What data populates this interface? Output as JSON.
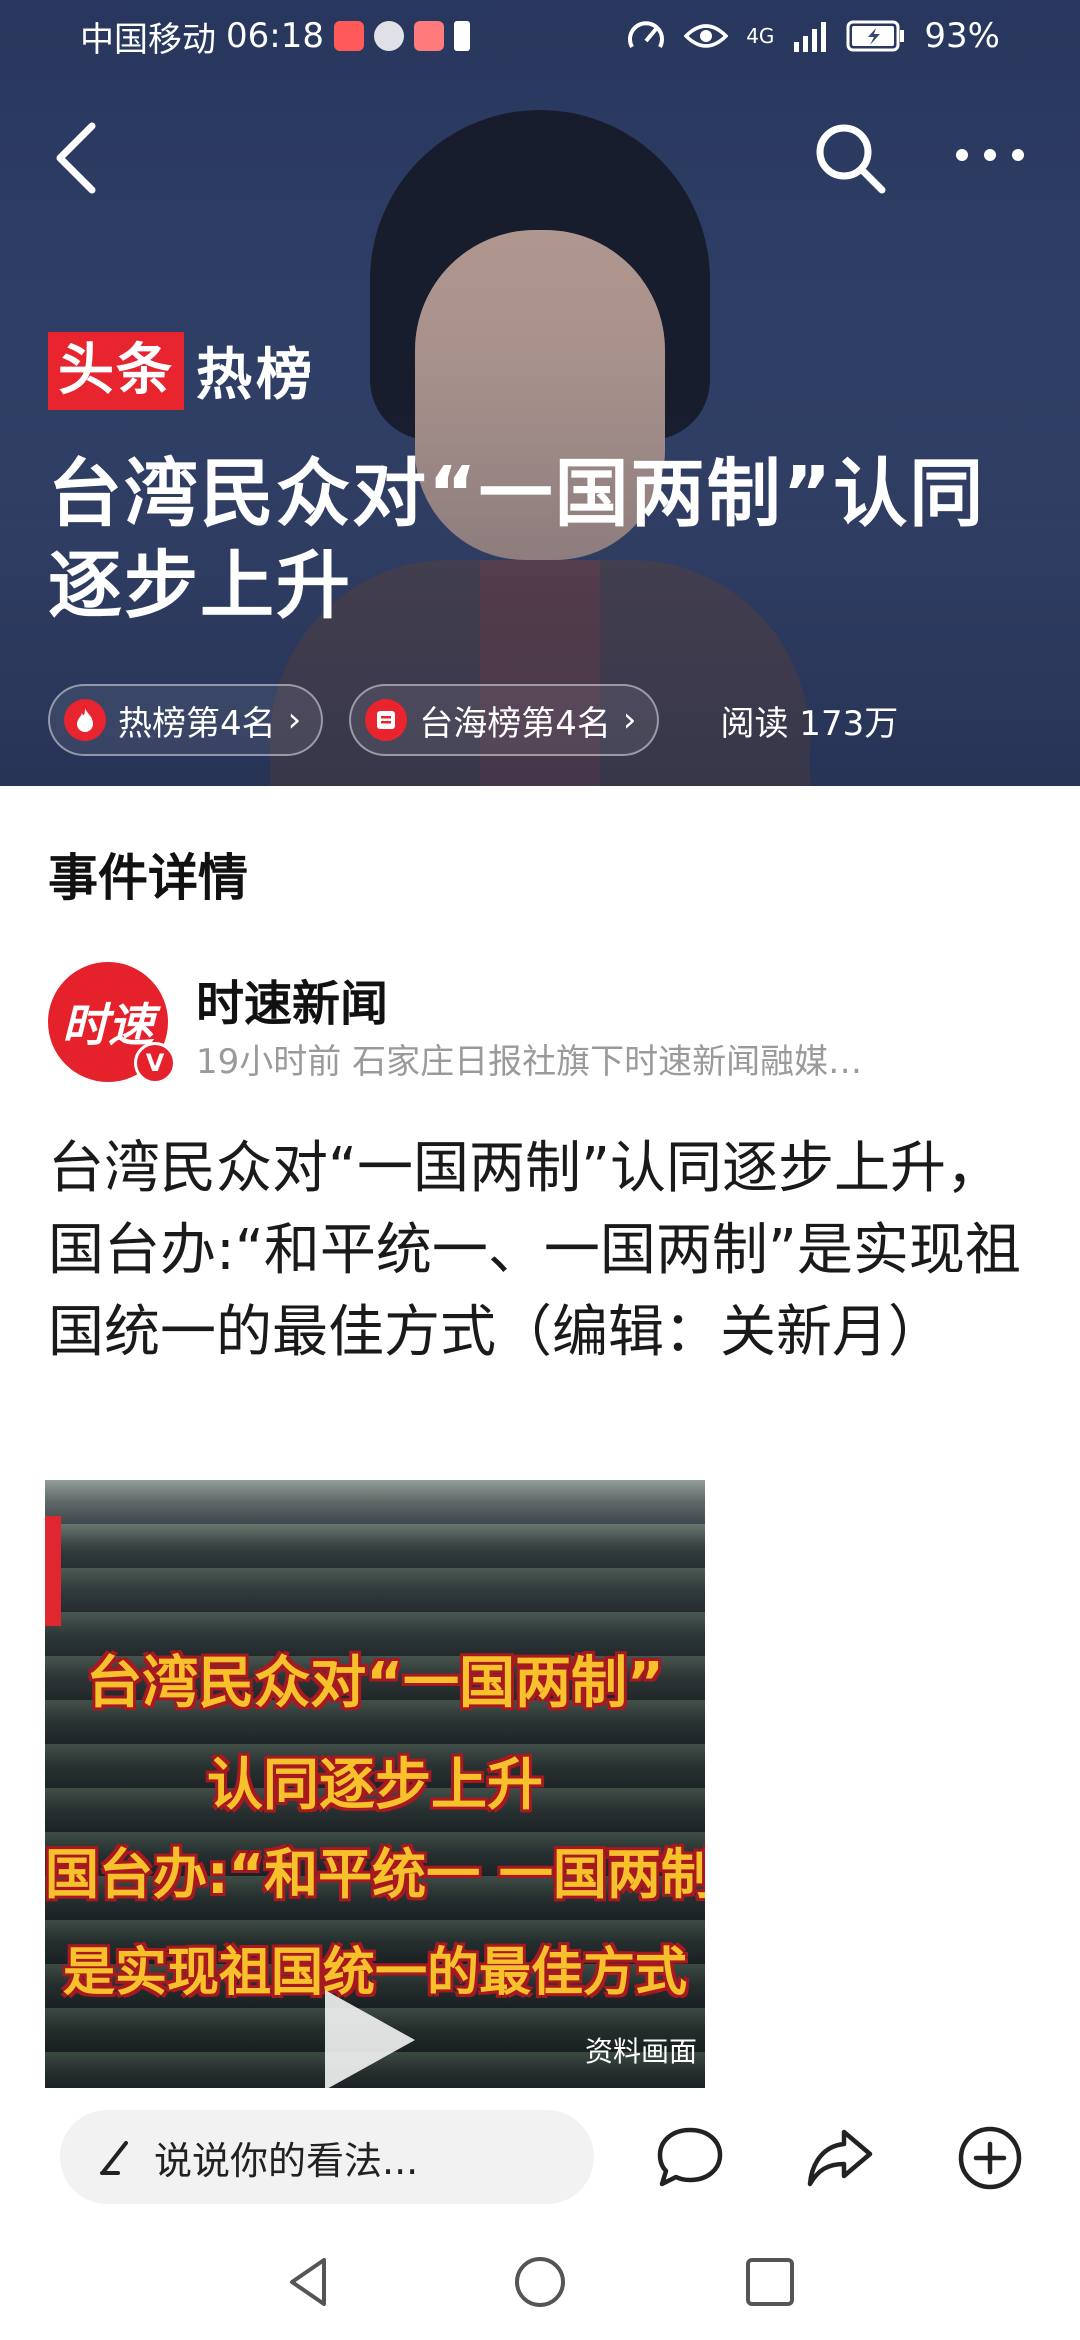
{
  "status": {
    "carrier": "中国移动",
    "time": "06:18",
    "network": "4G",
    "battery": "93%"
  },
  "hero": {
    "brand_red": "头条",
    "brand_white": "热榜",
    "title": "台湾民众对“一国两制”认同逐步上升",
    "chip1": "热榜第4名",
    "chip2": "台海榜第4名",
    "reads": "阅读 173万"
  },
  "section_title": "事件详情",
  "author": {
    "avatar_text": "时速",
    "badge": "V",
    "name": "时速新闻",
    "meta": "19小时前  石家庄日报社旗下时速新闻融媒…"
  },
  "post_text": "台湾民众对“一国两制”认同逐步上升，国台办:“和平统一、一国两制”是实现祖国统一的最佳方式（编辑：关新月）",
  "video": {
    "line1": "台湾民众对“一国两制”",
    "line2": "认同逐步上升",
    "line3": "国台办:“和平统一 一国两制”",
    "line4": "是实现祖国统一的最佳方式",
    "source": "资料画面"
  },
  "bottom": {
    "comment_placeholder": "说说你的看法..."
  },
  "icons": [
    "back-arrow-icon",
    "search-icon",
    "more-icon",
    "flame-icon",
    "list-icon",
    "pencil-icon",
    "comment-icon",
    "share-icon",
    "add-icon",
    "nav-back-icon",
    "nav-home-icon",
    "nav-recent-icon"
  ]
}
